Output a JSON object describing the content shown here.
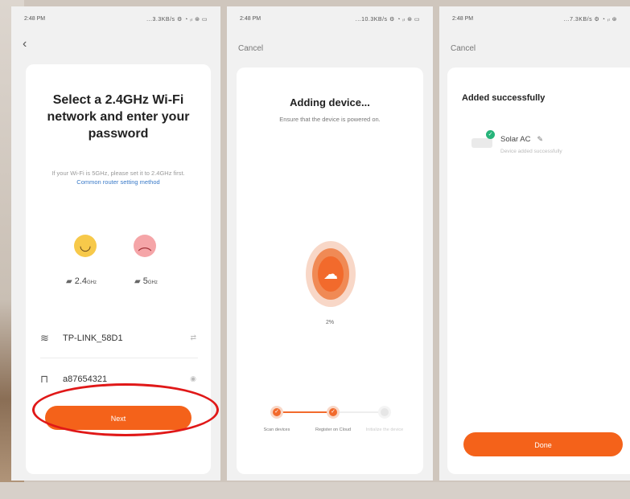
{
  "screen1": {
    "status_time": "2:48 PM",
    "status_icons": "...3.3KB/s ⚙ ◔ ᵢₗ ⊛ ▭",
    "back_icon": "‹",
    "title": "Select a 2.4GHz Wi-Fi network and enter your password",
    "hint_text": "If your Wi-Fi is 5GHz, please set it to 2.4GHz first.",
    "hint_link": "Common router setting method",
    "band_24_label": "2.4",
    "band_24_unit": "GHz",
    "band_5_label": "5",
    "band_5_unit": "GHz",
    "wifi_name": "TP-LINK_58D1",
    "password": "a87654321",
    "next_button": "Next"
  },
  "screen2": {
    "status_time": "2:48 PM",
    "status_icons": "...10.3KB/s ⚙ ◔ ᵢₗ ⊛ ▭",
    "cancel_label": "Cancel",
    "title": "Adding device...",
    "subtitle": "Ensure that the device is powered on.",
    "percent": "2%",
    "steps": [
      {
        "label": "Scan devices"
      },
      {
        "label": "Register on Cloud"
      },
      {
        "label": "Initialize the device"
      }
    ]
  },
  "screen3": {
    "status_time": "2:48 PM",
    "status_icons": "...7.3KB/s ⚙ ◔ ᵢₗ ⊛",
    "cancel_label": "Cancel",
    "title": "Added successfully",
    "device_name": "Solar AC",
    "device_status": "Device added successfully",
    "done_button": "Done"
  },
  "colors": {
    "accent": "#f4621a",
    "highlight_ring": "#e01818",
    "success": "#27b47a"
  }
}
